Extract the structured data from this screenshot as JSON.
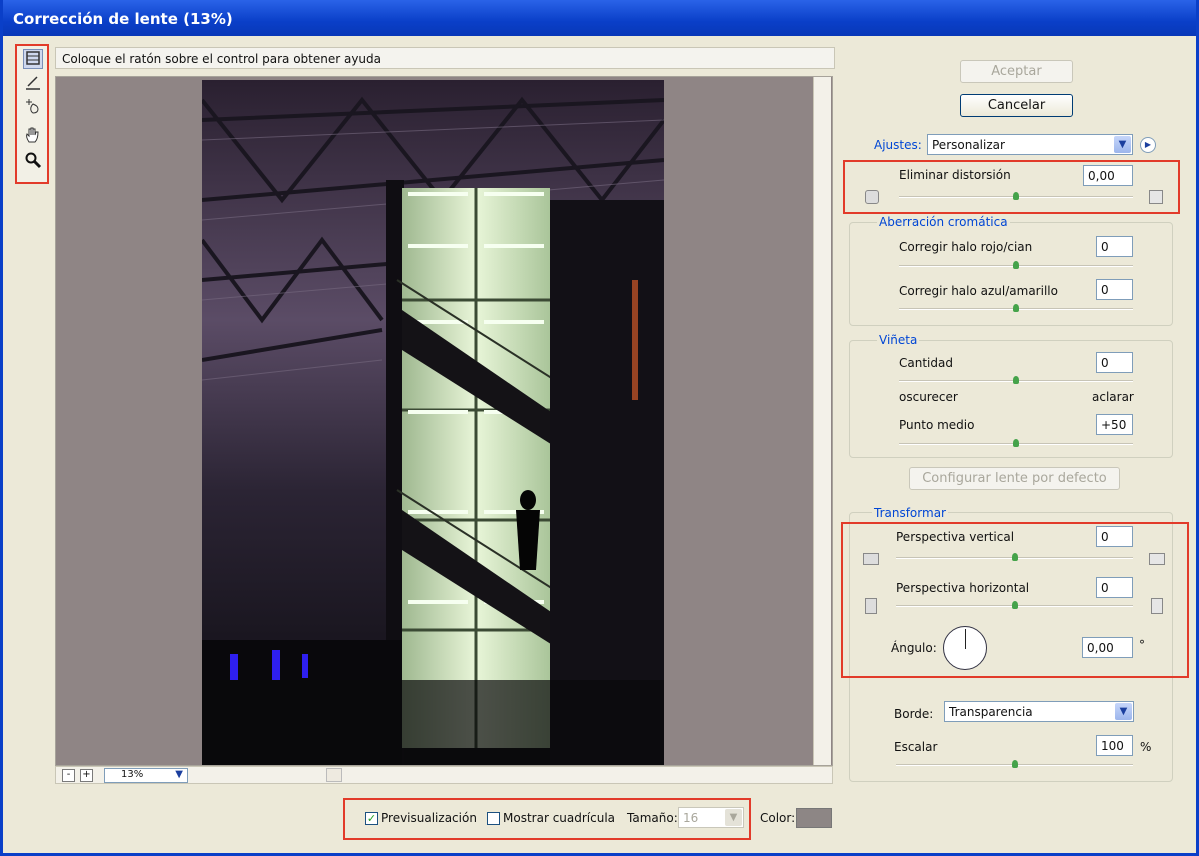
{
  "window": {
    "title": "Corrección de lente (13%)"
  },
  "help_text": "Coloque el ratón sobre el control para obtener ayuda",
  "zoom": {
    "value": "13%",
    "minus": "-",
    "plus": "+"
  },
  "buttons": {
    "accept": "Aceptar",
    "cancel": "Cancelar",
    "default_lens": "Configurar lente por defecto"
  },
  "settings": {
    "label": "Ajustes:",
    "value": "Personalizar"
  },
  "distortion": {
    "label": "Eliminar distorsión",
    "value": "0,00"
  },
  "chromatic": {
    "title": "Aberración cromática",
    "red_cyan_label": "Corregir halo rojo/cian",
    "red_cyan_value": "0",
    "blue_yellow_label": "Corregir halo azul/amarillo",
    "blue_yellow_value": "0"
  },
  "vignette": {
    "title": "Viñeta",
    "amount_label": "Cantidad",
    "amount_value": "0",
    "darken": "oscurecer",
    "lighten": "aclarar",
    "midpoint_label": "Punto medio",
    "midpoint_value": "+50"
  },
  "transform": {
    "title": "Transformar",
    "vertical_label": "Perspectiva vertical",
    "vertical_value": "0",
    "horizontal_label": "Perspectiva horizontal",
    "horizontal_value": "0",
    "angle_label": "Ángulo:",
    "angle_value": "0,00",
    "degree": "°"
  },
  "edge": {
    "label": "Borde:",
    "value": "Transparencia"
  },
  "scale": {
    "label": "Escalar",
    "value": "100",
    "unit": "%"
  },
  "bottom": {
    "preview_label": "Previsualización",
    "grid_label": "Mostrar cuadrícula",
    "size_label": "Tamaño:",
    "size_value": "16",
    "color_label": "Color:",
    "preview_checked": "✓"
  },
  "colors": {
    "highlight": "#e23b2a",
    "grid_color": "#8d8685"
  }
}
